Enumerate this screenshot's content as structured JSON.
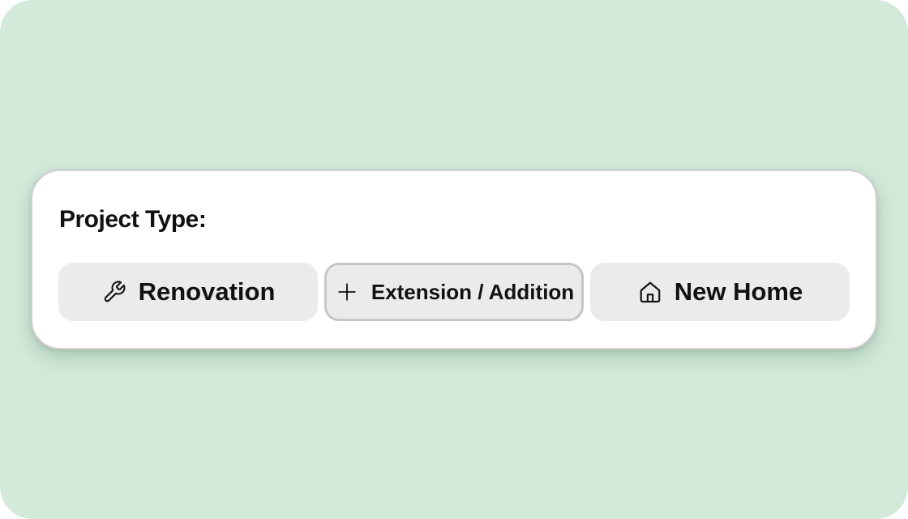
{
  "form": {
    "label": "Project Type:",
    "options": [
      {
        "label": "Renovation",
        "icon": "wrench-icon",
        "selected": false
      },
      {
        "label": "Extension / Addition",
        "icon": "plus-icon",
        "selected": true
      },
      {
        "label": "New Home",
        "icon": "house-icon",
        "selected": false
      }
    ]
  },
  "colors": {
    "background": "#d3eadb",
    "card": "#ffffff",
    "option_fill": "#ebebeb",
    "selected_border": "#c5c5c5",
    "text": "#111111"
  }
}
